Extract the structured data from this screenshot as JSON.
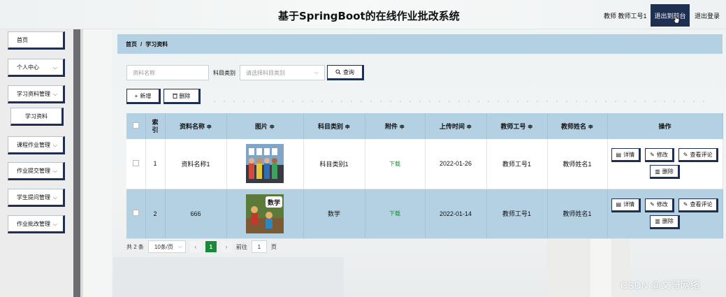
{
  "header": {
    "title": "基于SpringBoot的在线作业批改系统",
    "user_info": "教师 教师工号1",
    "front_button": "退出到前台",
    "logout": "退出登录"
  },
  "sidebar": {
    "items": [
      {
        "label": "首页"
      },
      {
        "label": "个人中心"
      },
      {
        "label": "学习资料管理"
      },
      {
        "label": "学习资料"
      },
      {
        "label": "课程作业管理"
      },
      {
        "label": "作业提交管理"
      },
      {
        "label": "学生提问管理"
      },
      {
        "label": "作业批改管理"
      }
    ]
  },
  "breadcrumb": {
    "home": "首页",
    "separator": "/",
    "current": "学习资料"
  },
  "search": {
    "name_placeholder": "资料名称",
    "category_label": "科目类别",
    "category_placeholder": "请选择科目类别",
    "query_button": "查询"
  },
  "toolbar": {
    "add_button": "新增",
    "delete_button": "删除"
  },
  "table": {
    "headers": {
      "index": "索引",
      "name": "资料名称 ≑",
      "image": "图片 ≑",
      "category": "科目类别 ≑",
      "attachment": "附件 ≑",
      "upload_time": "上传时间 ≑",
      "teacher_id": "教师工号 ≑",
      "teacher_name": "教师姓名 ≑",
      "actions": "操作"
    },
    "rows": [
      {
        "index": "1",
        "name": "资料名称1",
        "category": "科目类别1",
        "attachment": "下载",
        "upload_time": "2022-01-26",
        "teacher_id": "教师工号1",
        "teacher_name": "教师姓名1",
        "image": "hello-photo"
      },
      {
        "index": "2",
        "name": "666",
        "category": "数学",
        "attachment": "下载",
        "upload_time": "2022-01-14",
        "teacher_id": "教师工号1",
        "teacher_name": "教师姓名1",
        "image": "math-book-cover",
        "image_text": "数学"
      }
    ],
    "actions": {
      "detail": "详情",
      "edit": "修改",
      "review": "查看评论",
      "delete": "删除"
    }
  },
  "pagination": {
    "total": "共 2 条",
    "page_size": "10条/页",
    "current_page": "1",
    "goto_label": "前往",
    "goto_value": "1",
    "page_suffix": "页"
  },
  "watermark": "CSDN @文哥网络",
  "colors": {
    "accent": "#1e2f52",
    "header_blue": "#b4d1e3",
    "link_green": "#1a8a3a"
  }
}
